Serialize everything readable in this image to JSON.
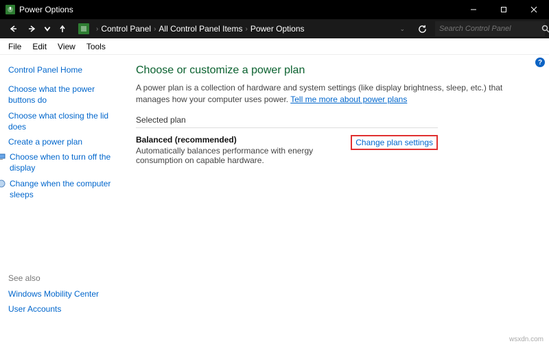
{
  "window": {
    "title": "Power Options"
  },
  "breadcrumb": {
    "cp": "Control Panel",
    "all": "All Control Panel Items",
    "page": "Power Options"
  },
  "search": {
    "placeholder": "Search Control Panel"
  },
  "menu": {
    "file": "File",
    "edit": "Edit",
    "view": "View",
    "tools": "Tools"
  },
  "sidebar": {
    "home": "Control Panel Home",
    "links": [
      "Choose what the power buttons do",
      "Choose what closing the lid does",
      "Create a power plan",
      "Choose when to turn off the display",
      "Change when the computer sleeps"
    ]
  },
  "seealso": {
    "hdr": "See also",
    "links": [
      "Windows Mobility Center",
      "User Accounts"
    ]
  },
  "main": {
    "heading": "Choose or customize a power plan",
    "desc1": "A power plan is a collection of hardware and system settings (like display brightness, sleep, etc.) that manages how your computer uses power. ",
    "learn": "Tell me more about power plans",
    "selected_hdr": "Selected plan",
    "plan_name": "Balanced (recommended)",
    "plan_desc": "Automatically balances performance with energy consumption on capable hardware.",
    "change": "Change plan settings"
  },
  "help": "?",
  "watermark": "wsxdn.com"
}
